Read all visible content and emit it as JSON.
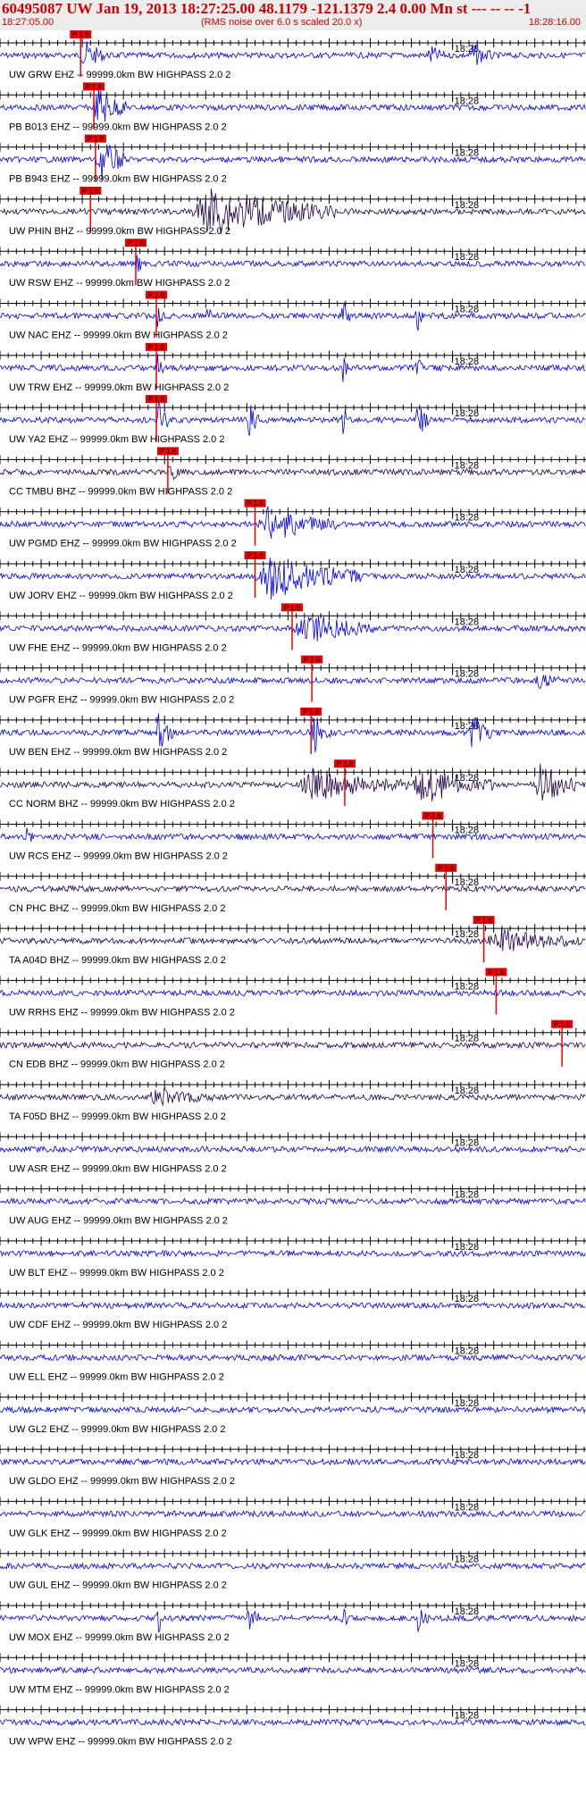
{
  "header": {
    "title": "60495087 UW Jan 19, 2013 18:27:25.00   48.1179 -121.1379  2.4 0.00 Mn st --- -- --  -1",
    "start_time": "18:27:05.00",
    "note": "(RMS noise over 6.0 s scaled 20.0 x)",
    "end_time": "18:28:16.00"
  },
  "chart_data": {
    "type": "line",
    "title": "60495087 UW Jan 19, 2013 18:27:25.00   48.1179 -121.1379  2.4 0.00 Mn st --- -- --  -1",
    "x_range_seconds": [
      0,
      71
    ],
    "x_start_label": "18:27:05.00",
    "x_end_label": "18:28:16.00",
    "minute_tick_label": "18:28",
    "minute_tick_seconds": 55,
    "pick_label": "P 1.6",
    "colors": {
      "blue": "#0000ee",
      "dark": "#22004a",
      "pick": "#ee0000",
      "axis": "#000000"
    },
    "traces": [
      {
        "label": "UW GRW EHZ -- 99999.0km BW  HIGHPASS  2.0  2",
        "color": "blue",
        "pick_s": 9.8,
        "bursts": [
          {
            "t": 9.8,
            "dur": 3,
            "amp": 1.4
          },
          {
            "t": 52,
            "dur": 2,
            "amp": 0.9
          },
          {
            "t": 57,
            "dur": 3,
            "amp": 1.0
          }
        ]
      },
      {
        "label": "PB B013 EHZ -- 99999.0km BW  HIGHPASS  2.0  2",
        "color": "blue",
        "pick_s": 11.4,
        "bursts": [
          {
            "t": 11.4,
            "dur": 4,
            "amp": 2.0
          }
        ]
      },
      {
        "label": "PB B943 EHZ -- 99999.0km BW  HIGHPASS  2.0  2",
        "color": "blue",
        "pick_s": 11.6,
        "bursts": [
          {
            "t": 11.6,
            "dur": 4,
            "amp": 2.0
          }
        ]
      },
      {
        "label": "UW PHIN BHZ -- 99999.0km BW  HIGHPASS  2.0  2",
        "color": "dark",
        "pick_s": 11.0,
        "bursts": [
          {
            "t": 23,
            "dur": 18,
            "amp": 2.2
          }
        ]
      },
      {
        "label": "UW RSW EHZ -- 99999.0km BW  HIGHPASS  2.0  2",
        "color": "blue",
        "pick_s": 16.5,
        "bursts": [
          {
            "t": 16.5,
            "dur": 1,
            "amp": 1.0
          }
        ]
      },
      {
        "label": "UW NAC EHZ -- 99999.0km BW  HIGHPASS  2.0  2",
        "color": "blue",
        "pick_s": 19.0,
        "bursts": [
          {
            "t": 19,
            "dur": 1,
            "amp": 1.3
          },
          {
            "t": 25,
            "dur": 1,
            "amp": 1.0
          },
          {
            "t": 41.5,
            "dur": 1,
            "amp": 1.6
          },
          {
            "t": 50.5,
            "dur": 1,
            "amp": 1.6
          }
        ]
      },
      {
        "label": "UW TRW EHZ -- 99999.0km BW  HIGHPASS  2.0  2",
        "color": "blue",
        "pick_s": 19.0,
        "bursts": [
          {
            "t": 19,
            "dur": 1,
            "amp": 1.2
          },
          {
            "t": 41.5,
            "dur": 1,
            "amp": 1.4
          },
          {
            "t": 50.5,
            "dur": 1,
            "amp": 1.1
          }
        ]
      },
      {
        "label": "UW YA2 EHZ -- 99999.0km BW  HIGHPASS  2.0  2",
        "color": "blue",
        "pick_s": 19.0,
        "bursts": [
          {
            "t": 19,
            "dur": 1.5,
            "amp": 2.0
          },
          {
            "t": 30,
            "dur": 1.5,
            "amp": 1.8
          },
          {
            "t": 41.5,
            "dur": 1,
            "amp": 1.8
          },
          {
            "t": 50.5,
            "dur": 1.5,
            "amp": 2.0
          }
        ]
      },
      {
        "label": "CC TMBU BHZ -- 99999.0km BW  HIGHPASS  2.0  2",
        "color": "dark",
        "pick_s": 20.4,
        "bursts": [
          {
            "t": 20.4,
            "dur": 1.5,
            "amp": 1.1
          }
        ]
      },
      {
        "label": "UW PGMD EHZ -- 99999.0km BW  HIGHPASS  2.0  2",
        "color": "blue",
        "pick_s": 31.0,
        "bursts": [
          {
            "t": 31,
            "dur": 10,
            "amp": 1.6
          }
        ]
      },
      {
        "label": "UW JORV EHZ -- 99999.0km BW  HIGHPASS  2.0  2",
        "color": "blue",
        "pick_s": 31.0,
        "bursts": [
          {
            "t": 31,
            "dur": 13,
            "amp": 2.0
          }
        ]
      },
      {
        "label": "UW FHE EHZ -- 99999.0km BW  HIGHPASS  2.0  2",
        "color": "blue",
        "pick_s": 35.5,
        "bursts": [
          {
            "t": 35.5,
            "dur": 10,
            "amp": 1.4
          }
        ]
      },
      {
        "label": "UW PGFR EHZ -- 99999.0km BW  HIGHPASS  2.0  2",
        "color": "blue",
        "pick_s": 37.9,
        "bursts": [
          {
            "t": 65,
            "dur": 3,
            "amp": 0.6
          }
        ]
      },
      {
        "label": "UW BEN EHZ -- 99999.0km BW  HIGHPASS  2.0  2",
        "color": "blue",
        "pick_s": 37.8,
        "bursts": [
          {
            "t": 19,
            "dur": 2,
            "amp": 1.8
          },
          {
            "t": 37.8,
            "dur": 2.5,
            "amp": 1.8
          },
          {
            "t": 57,
            "dur": 3,
            "amp": 1.8
          }
        ]
      },
      {
        "label": "CC NORM BHZ -- 99999.0km BW  HIGHPASS  2.0  2",
        "color": "dark",
        "pick_s": 41.9,
        "bursts": [
          {
            "t": 36,
            "dur": 14,
            "amp": 1.4
          },
          {
            "t": 50,
            "dur": 10,
            "amp": 1.7
          },
          {
            "t": 65,
            "dur": 5,
            "amp": 2.0
          }
        ]
      },
      {
        "label": "UW RCS EHZ -- 99999.0km BW  HIGHPASS  2.0  2",
        "color": "blue",
        "pick_s": 52.6,
        "bursts": [
          {
            "t": 3,
            "dur": 1,
            "amp": 0.9
          }
        ]
      },
      {
        "label": "CN PHC BHZ -- 99999.0km BW  HIGHPASS  2.0  2",
        "color": "dark",
        "pick_s": 54.2,
        "bursts": []
      },
      {
        "label": "TA A04D BHZ -- 99999.0km BW  HIGHPASS  2.0  2",
        "color": "dark",
        "pick_s": 58.8,
        "bursts": [
          {
            "t": 59,
            "dur": 12,
            "amp": 1.0
          }
        ]
      },
      {
        "label": "UW RRHS EHZ -- 99999.0km BW  HIGHPASS  2.0  2",
        "color": "blue",
        "pick_s": 60.3,
        "bursts": []
      },
      {
        "label": "CN EDB BHZ -- 99999.0km BW  HIGHPASS  2.0  2",
        "color": "dark",
        "pick_s": 68.3,
        "bursts": []
      },
      {
        "label": "TA F05D BHZ -- 99999.0km BW  HIGHPASS  2.0  2",
        "color": "dark",
        "pick_s": null,
        "bursts": [
          {
            "t": 18,
            "dur": 8,
            "amp": 0.7
          }
        ]
      },
      {
        "label": "UW ASR EHZ -- 99999.0km BW  HIGHPASS  2.0  2",
        "color": "blue",
        "pick_s": null,
        "bursts": []
      },
      {
        "label": "UW AUG EHZ -- 99999.0km BW  HIGHPASS  2.0  2",
        "color": "blue",
        "pick_s": null,
        "bursts": []
      },
      {
        "label": "UW BLT EHZ -- 99999.0km BW  HIGHPASS  2.0  2",
        "color": "blue",
        "pick_s": null,
        "bursts": []
      },
      {
        "label": "UW CDF EHZ -- 99999.0km BW  HIGHPASS  2.0  2",
        "color": "blue",
        "pick_s": null,
        "bursts": []
      },
      {
        "label": "UW ELL EHZ -- 99999.0km BW  HIGHPASS  2.0  2",
        "color": "blue",
        "pick_s": null,
        "bursts": []
      },
      {
        "label": "UW GL2 EHZ -- 99999.0km BW  HIGHPASS  2.0  2",
        "color": "blue",
        "pick_s": null,
        "bursts": []
      },
      {
        "label": "UW GLDO EHZ -- 99999.0km BW  HIGHPASS  2.0  2",
        "color": "blue",
        "pick_s": null,
        "bursts": []
      },
      {
        "label": "UW GLK EHZ -- 99999.0km BW  HIGHPASS  2.0  2",
        "color": "blue",
        "pick_s": null,
        "bursts": []
      },
      {
        "label": "UW GUL EHZ -- 99999.0km BW  HIGHPASS  2.0  2",
        "color": "blue",
        "pick_s": null,
        "bursts": []
      },
      {
        "label": "UW MOX EHZ -- 99999.0km BW  HIGHPASS  2.0  2",
        "color": "blue",
        "pick_s": null,
        "bursts": [
          {
            "t": 19,
            "dur": 1.5,
            "amp": 1.3
          },
          {
            "t": 30,
            "dur": 1.5,
            "amp": 1.3
          },
          {
            "t": 41.5,
            "dur": 1,
            "amp": 1.3
          },
          {
            "t": 50.5,
            "dur": 1.5,
            "amp": 1.3
          }
        ]
      },
      {
        "label": "UW MTM EHZ -- 99999.0km BW  HIGHPASS  2.0  2",
        "color": "blue",
        "pick_s": null,
        "bursts": []
      },
      {
        "label": "UW WPW EHZ -- 99999.0km BW  HIGHPASS  2.0  2",
        "color": "blue",
        "pick_s": null,
        "bursts": []
      }
    ]
  }
}
